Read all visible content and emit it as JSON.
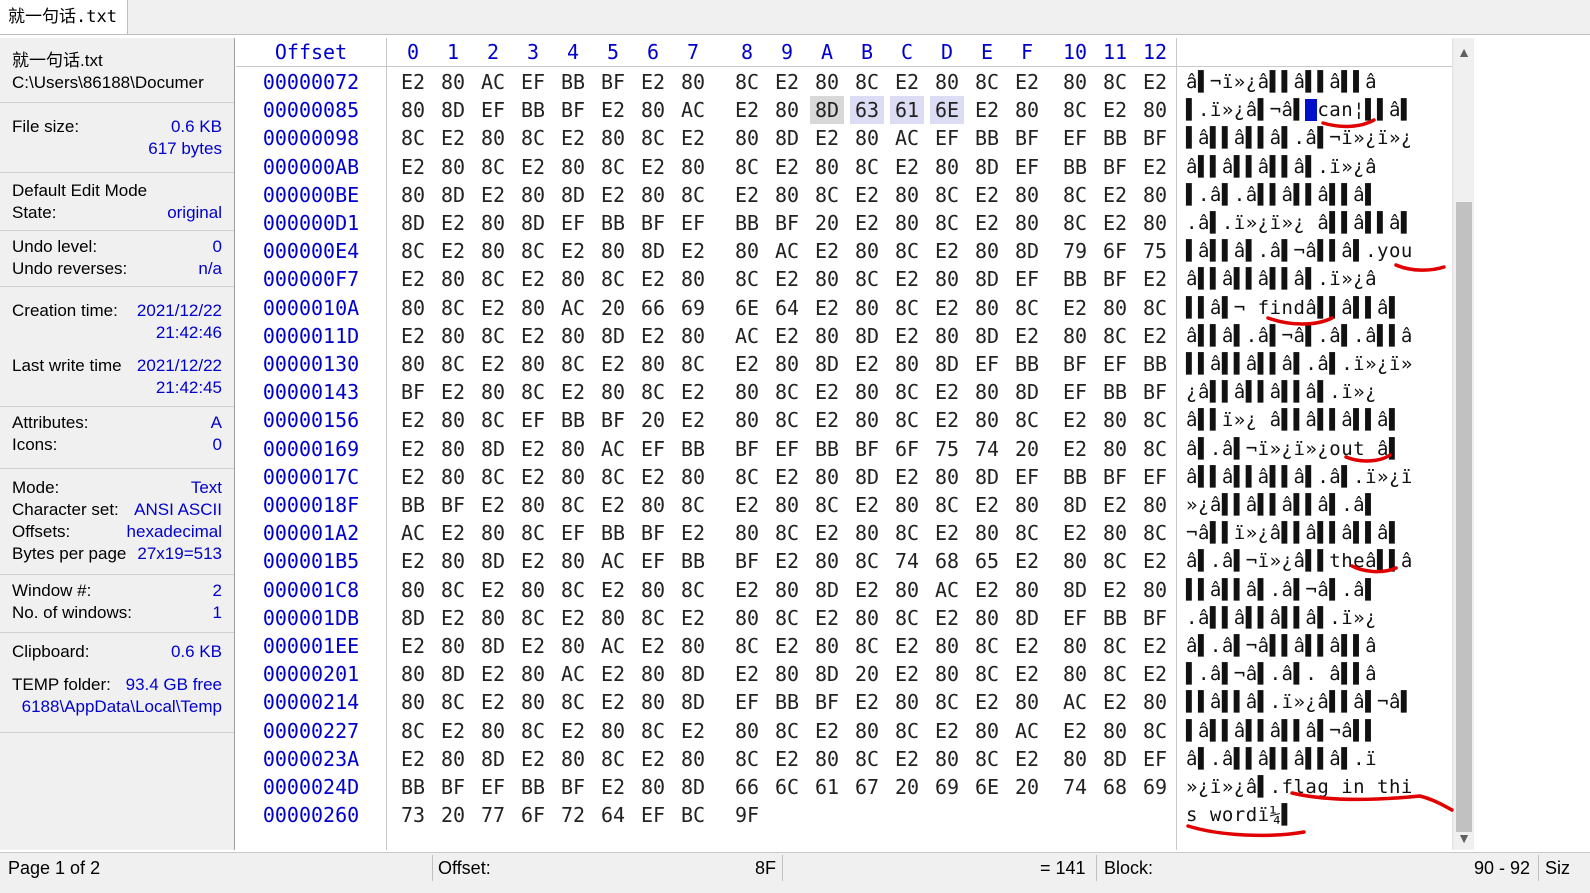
{
  "tab": {
    "label": "就一句话.txt"
  },
  "side": {
    "filename": "就一句话.txt",
    "path": "C:\\Users\\86188\\Documer",
    "filesize_label": "File size:",
    "filesize_kb": "0.6 KB",
    "filesize_bytes": "617 bytes",
    "editmode_label": "Default Edit Mode",
    "state_label": "State:",
    "state_value": "original",
    "undo_level_label": "Undo level:",
    "undo_level_value": "0",
    "undo_rev_label": "Undo reverses:",
    "undo_rev_value": "n/a",
    "creation_label": "Creation time:",
    "creation_date": "2021/12/22",
    "creation_time": "21:42:46",
    "lastwrite_label": "Last write time",
    "lastwrite_date": "2021/12/22",
    "lastwrite_time": "21:42:45",
    "attributes_label": "Attributes:",
    "attributes_value": "A",
    "icons_label": "Icons:",
    "icons_value": "0",
    "mode_label": "Mode:",
    "mode_value": "Text",
    "charset_label": "Character set:",
    "charset_value": "ANSI ASCII",
    "offsets_label": "Offsets:",
    "offsets_value": "hexadecimal",
    "bpp_label": "Bytes per page",
    "bpp_value": "27x19=513",
    "window_label": "Window #:",
    "window_value": "2",
    "nwin_label": "No. of windows:",
    "nwin_value": "1",
    "clipboard_label": "Clipboard:",
    "clipboard_value": "0.6 KB",
    "temp_label": "TEMP folder:",
    "temp_value": "93.4 GB free",
    "temp_path": "6188\\AppData\\Local\\Temp"
  },
  "header": {
    "offset": "Offset",
    "cols": [
      "0",
      "1",
      "2",
      "3",
      "4",
      "5",
      "6",
      "7",
      "8",
      "9",
      "A",
      "B",
      "C",
      "D",
      "E",
      "F",
      "10",
      "11",
      "12"
    ]
  },
  "rows": [
    {
      "off": "00000072",
      "bytes": [
        "E2",
        "80",
        "AC",
        "EF",
        "BB",
        "BF",
        "E2",
        "80",
        "8C",
        "E2",
        "80",
        "8C",
        "E2",
        "80",
        "8C",
        "E2",
        "80",
        "8C",
        "E2"
      ],
      "ascii": "â¬ï»¿âââââ"
    },
    {
      "off": "00000085",
      "bytes": [
        "80",
        "8D",
        "EF",
        "BB",
        "BF",
        "E2",
        "80",
        "AC",
        "E2",
        "80",
        "8D",
        "63",
        "61",
        "6E",
        "E2",
        "80",
        "8C",
        "E2",
        "80"
      ],
      "ascii": "..."
    },
    {
      "off": "00000098",
      "bytes": [
        "8C",
        "E2",
        "80",
        "8C",
        "E2",
        "80",
        "8C",
        "E2",
        "80",
        "8D",
        "E2",
        "80",
        "AC",
        "EF",
        "BB",
        "BF",
        "EF",
        "BB",
        "BF"
      ],
      "ascii": "..."
    },
    {
      "off": "000000AB",
      "bytes": [
        "E2",
        "80",
        "8C",
        "E2",
        "80",
        "8C",
        "E2",
        "80",
        "8C",
        "E2",
        "80",
        "8C",
        "E2",
        "80",
        "8D",
        "EF",
        "BB",
        "BF",
        "E2"
      ],
      "ascii": "..."
    },
    {
      "off": "000000BE",
      "bytes": [
        "80",
        "8D",
        "E2",
        "80",
        "8D",
        "E2",
        "80",
        "8C",
        "E2",
        "80",
        "8C",
        "E2",
        "80",
        "8C",
        "E2",
        "80",
        "8C",
        "E2",
        "80"
      ],
      "ascii": "..."
    },
    {
      "off": "000000D1",
      "bytes": [
        "8D",
        "E2",
        "80",
        "8D",
        "EF",
        "BB",
        "BF",
        "EF",
        "BB",
        "BF",
        "20",
        "E2",
        "80",
        "8C",
        "E2",
        "80",
        "8C",
        "E2",
        "80"
      ],
      "ascii": "..."
    },
    {
      "off": "000000E4",
      "bytes": [
        "8C",
        "E2",
        "80",
        "8C",
        "E2",
        "80",
        "8D",
        "E2",
        "80",
        "AC",
        "E2",
        "80",
        "8C",
        "E2",
        "80",
        "8D",
        "79",
        "6F",
        "75"
      ],
      "ascii": "..."
    },
    {
      "off": "000000F7",
      "bytes": [
        "E2",
        "80",
        "8C",
        "E2",
        "80",
        "8C",
        "E2",
        "80",
        "8C",
        "E2",
        "80",
        "8C",
        "E2",
        "80",
        "8D",
        "EF",
        "BB",
        "BF",
        "E2"
      ],
      "ascii": "..."
    },
    {
      "off": "0000010A",
      "bytes": [
        "80",
        "8C",
        "E2",
        "80",
        "AC",
        "20",
        "66",
        "69",
        "6E",
        "64",
        "E2",
        "80",
        "8C",
        "E2",
        "80",
        "8C",
        "E2",
        "80",
        "8C"
      ],
      "ascii": "..."
    },
    {
      "off": "0000011D",
      "bytes": [
        "E2",
        "80",
        "8C",
        "E2",
        "80",
        "8D",
        "E2",
        "80",
        "AC",
        "E2",
        "80",
        "8D",
        "E2",
        "80",
        "8D",
        "E2",
        "80",
        "8C",
        "E2"
      ],
      "ascii": "..."
    },
    {
      "off": "00000130",
      "bytes": [
        "80",
        "8C",
        "E2",
        "80",
        "8C",
        "E2",
        "80",
        "8C",
        "E2",
        "80",
        "8D",
        "E2",
        "80",
        "8D",
        "EF",
        "BB",
        "BF",
        "EF",
        "BB"
      ],
      "ascii": "..."
    },
    {
      "off": "00000143",
      "bytes": [
        "BF",
        "E2",
        "80",
        "8C",
        "E2",
        "80",
        "8C",
        "E2",
        "80",
        "8C",
        "E2",
        "80",
        "8C",
        "E2",
        "80",
        "8D",
        "EF",
        "BB",
        "BF"
      ],
      "ascii": "..."
    },
    {
      "off": "00000156",
      "bytes": [
        "E2",
        "80",
        "8C",
        "EF",
        "BB",
        "BF",
        "20",
        "E2",
        "80",
        "8C",
        "E2",
        "80",
        "8C",
        "E2",
        "80",
        "8C",
        "E2",
        "80",
        "8C"
      ],
      "ascii": "..."
    },
    {
      "off": "00000169",
      "bytes": [
        "E2",
        "80",
        "8D",
        "E2",
        "80",
        "AC",
        "EF",
        "BB",
        "BF",
        "EF",
        "BB",
        "BF",
        "6F",
        "75",
        "74",
        "20",
        "E2",
        "80",
        "8C"
      ],
      "ascii": "..."
    },
    {
      "off": "0000017C",
      "bytes": [
        "E2",
        "80",
        "8C",
        "E2",
        "80",
        "8C",
        "E2",
        "80",
        "8C",
        "E2",
        "80",
        "8D",
        "E2",
        "80",
        "8D",
        "EF",
        "BB",
        "BF",
        "EF"
      ],
      "ascii": "..."
    },
    {
      "off": "0000018F",
      "bytes": [
        "BB",
        "BF",
        "E2",
        "80",
        "8C",
        "E2",
        "80",
        "8C",
        "E2",
        "80",
        "8C",
        "E2",
        "80",
        "8C",
        "E2",
        "80",
        "8D",
        "E2",
        "80"
      ],
      "ascii": "..."
    },
    {
      "off": "000001A2",
      "bytes": [
        "AC",
        "E2",
        "80",
        "8C",
        "EF",
        "BB",
        "BF",
        "E2",
        "80",
        "8C",
        "E2",
        "80",
        "8C",
        "E2",
        "80",
        "8C",
        "E2",
        "80",
        "8C"
      ],
      "ascii": "..."
    },
    {
      "off": "000001B5",
      "bytes": [
        "E2",
        "80",
        "8D",
        "E2",
        "80",
        "AC",
        "EF",
        "BB",
        "BF",
        "E2",
        "80",
        "8C",
        "74",
        "68",
        "65",
        "E2",
        "80",
        "8C",
        "E2"
      ],
      "ascii": "..."
    },
    {
      "off": "000001C8",
      "bytes": [
        "80",
        "8C",
        "E2",
        "80",
        "8C",
        "E2",
        "80",
        "8C",
        "E2",
        "80",
        "8D",
        "E2",
        "80",
        "AC",
        "E2",
        "80",
        "8D",
        "E2",
        "80"
      ],
      "ascii": "..."
    },
    {
      "off": "000001DB",
      "bytes": [
        "8D",
        "E2",
        "80",
        "8C",
        "E2",
        "80",
        "8C",
        "E2",
        "80",
        "8C",
        "E2",
        "80",
        "8C",
        "E2",
        "80",
        "8D",
        "EF",
        "BB",
        "BF"
      ],
      "ascii": "..."
    },
    {
      "off": "000001EE",
      "bytes": [
        "E2",
        "80",
        "8D",
        "E2",
        "80",
        "AC",
        "E2",
        "80",
        "8C",
        "E2",
        "80",
        "8C",
        "E2",
        "80",
        "8C",
        "E2",
        "80",
        "8C",
        "E2"
      ],
      "ascii": "..."
    },
    {
      "off": "00000201",
      "bytes": [
        "80",
        "8D",
        "E2",
        "80",
        "AC",
        "E2",
        "80",
        "8D",
        "E2",
        "80",
        "8D",
        "20",
        "E2",
        "80",
        "8C",
        "E2",
        "80",
        "8C",
        "E2"
      ],
      "ascii": "..."
    },
    {
      "off": "00000214",
      "bytes": [
        "80",
        "8C",
        "E2",
        "80",
        "8C",
        "E2",
        "80",
        "8D",
        "EF",
        "BB",
        "BF",
        "E2",
        "80",
        "8C",
        "E2",
        "80",
        "AC",
        "E2",
        "80"
      ],
      "ascii": "..."
    },
    {
      "off": "00000227",
      "bytes": [
        "8C",
        "E2",
        "80",
        "8C",
        "E2",
        "80",
        "8C",
        "E2",
        "80",
        "8C",
        "E2",
        "80",
        "8C",
        "E2",
        "80",
        "AC",
        "E2",
        "80",
        "8C"
      ],
      "ascii": "..."
    },
    {
      "off": "0000023A",
      "bytes": [
        "E2",
        "80",
        "8D",
        "E2",
        "80",
        "8C",
        "E2",
        "80",
        "8C",
        "E2",
        "80",
        "8C",
        "E2",
        "80",
        "8C",
        "E2",
        "80",
        "8D",
        "EF"
      ],
      "ascii": "..."
    },
    {
      "off": "0000024D",
      "bytes": [
        "BB",
        "BF",
        "EF",
        "BB",
        "BF",
        "E2",
        "80",
        "8D",
        "66",
        "6C",
        "61",
        "67",
        "20",
        "69",
        "6E",
        "20",
        "74",
        "68",
        "69"
      ],
      "ascii": "..."
    },
    {
      "off": "00000260",
      "bytes": [
        "73",
        "20",
        "77",
        "6F",
        "72",
        "64",
        "EF",
        "BC",
        "9F"
      ],
      "ascii": "..."
    }
  ],
  "ascii_text": [
    "â▌¬ï»¿â▌▌â▌▌â▌▌â",
    "▌.ï»¿â▌¬â▌▐can¦▌▌â▌",
    "▌â▌▌â▌▌â▌.â▌¬ï»¿ï»¿",
    "â▌▌â▌▌â▌▌â▌.ï»¿â",
    "▌.â▌.â▌▌â▌▌â▌▌â▌",
    ".â▌.ï»¿ï»¿ â▌▌â▌▌â▌",
    "▌â▌▌â▌.â▌¬â▌▌â▌.you",
    "â▌▌â▌▌â▌▌â▌.ï»¿â",
    "▌▌â▌¬ findâ▌▌â▌▌â▌",
    "â▌▌â▌.â▌¬â▌.â▌.â▌▌â",
    "▌▌â▌▌â▌▌â▌.â▌.ï»¿ï»",
    "¿â▌▌â▌▌â▌▌â▌.ï»¿",
    "â▌▌ï»¿ â▌▌â▌▌â▌▌â▌",
    "â▌.â▌¬ï»¿ï»¿out â▌",
    "â▌▌â▌▌â▌▌â▌.â▌.ï»¿ï",
    "»¿â▌▌â▌▌â▌▌â▌.â▌",
    "¬â▌▌ï»¿â▌▌â▌▌â▌▌â▌",
    "â▌.â▌¬ï»¿â▌▌theâ▌▌â",
    "▌▌â▌▌â▌.â▌¬â▌.â▌",
    ".â▌▌â▌▌â▌▌â▌.ï»¿",
    "â▌.â▌¬â▌▌â▌▌â▌▌â",
    "▌.â▌¬â▌.â▌. â▌▌â",
    "▌▌â▌▌â▌.ï»¿â▌▌â▌¬â▌",
    "▌â▌▌â▌▌â▌▌â▌¬â▌▌",
    "â▌.â▌▌â▌▌â▌▌â▌.ï",
    "»¿ï»¿â▌.flag in thi",
    "s wordï¼▌"
  ],
  "selection": {
    "row": 1,
    "cursor_col": 10,
    "sel_cols": [
      11,
      12,
      13
    ]
  },
  "status": {
    "page": "Page 1 of 2",
    "offset_label": "Offset:",
    "offset_value": "8F",
    "eq_value": "= 141",
    "block_label": "Block:",
    "block_value": "90 - 92",
    "size_label": "Siz"
  },
  "colors": {
    "accent": "#0000cc",
    "selection": "#dcdcf5",
    "cursor": "#0010c8",
    "marker": "#e00000"
  }
}
